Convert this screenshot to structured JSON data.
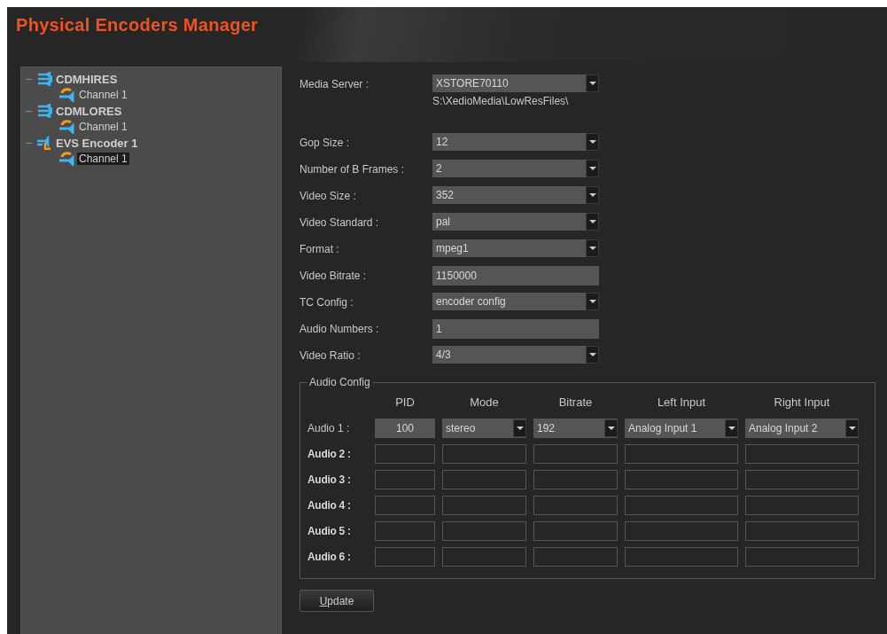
{
  "window": {
    "title": "Physical Encoders Manager"
  },
  "tree": [
    {
      "label": "CDMHIRES",
      "kind": "server",
      "expanded": true,
      "children": [
        {
          "label": "Channel 1",
          "kind": "channel",
          "selected": false
        }
      ]
    },
    {
      "label": "CDMLORES",
      "kind": "server",
      "expanded": true,
      "children": [
        {
          "label": "Channel 1",
          "kind": "channel",
          "selected": false
        }
      ]
    },
    {
      "label": "EVS Encoder 1",
      "kind": "encoder",
      "expanded": true,
      "children": [
        {
          "label": "Channel 1",
          "kind": "channel",
          "selected": true
        }
      ]
    }
  ],
  "media_server": {
    "label": "Media Server :",
    "value": "XSTORE70110",
    "path": "S:\\XedioMedia\\LowResFiles\\"
  },
  "fields": [
    {
      "label": "Gop Size :",
      "kind": "select",
      "value": "12"
    },
    {
      "label": "Number of B Frames :",
      "kind": "select",
      "value": "2"
    },
    {
      "label": "Video Size :",
      "kind": "select",
      "value": "352"
    },
    {
      "label": "Video Standard :",
      "kind": "select",
      "value": "pal"
    },
    {
      "label": "Format :",
      "kind": "select",
      "value": "mpeg1"
    },
    {
      "label": "Video Bitrate :",
      "kind": "text",
      "value": "1150000"
    },
    {
      "label": "TC Config :",
      "kind": "select",
      "value": "encoder config"
    },
    {
      "label": "Audio Numbers :",
      "kind": "text",
      "value": "1"
    },
    {
      "label": "Video Ratio :",
      "kind": "select",
      "value": "4/3"
    }
  ],
  "audio_config": {
    "title": "Audio Config",
    "columns": [
      "PID",
      "Mode",
      "Bitrate",
      "Left Input",
      "Right Input"
    ],
    "rows": [
      {
        "label": "Audio 1 :",
        "enabled": true,
        "pid": "100",
        "mode": "stereo",
        "bitrate": "192",
        "left_input": "Analog Input 1",
        "right_input": "Analog Input 2"
      },
      {
        "label": "Audio 2 :",
        "enabled": false
      },
      {
        "label": "Audio 3 :",
        "enabled": false
      },
      {
        "label": "Audio 4 :",
        "enabled": false
      },
      {
        "label": "Audio 5 :",
        "enabled": false
      },
      {
        "label": "Audio 6 :",
        "enabled": false
      }
    ]
  },
  "buttons": [
    {
      "label": "Update"
    }
  ]
}
